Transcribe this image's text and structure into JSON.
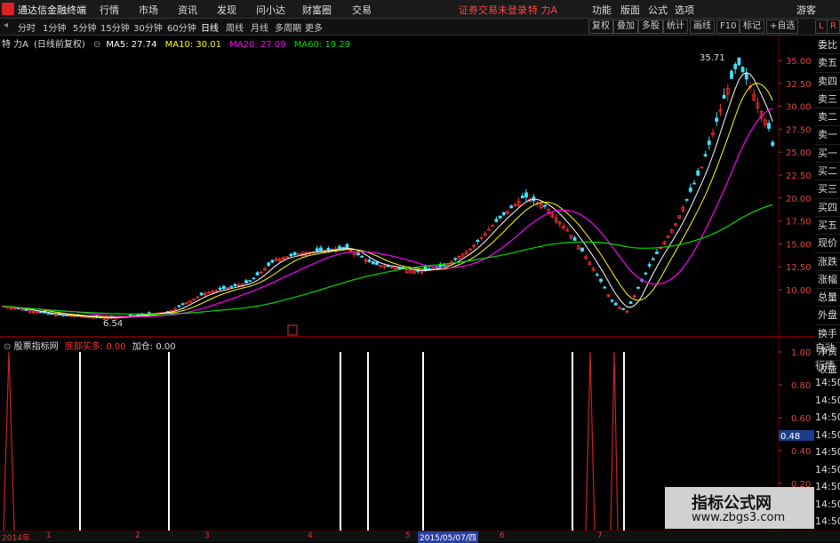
{
  "menubar": {
    "app_name": "通达信金融终端",
    "items": [
      "行情",
      "市场",
      "资讯",
      "发现",
      "问小达",
      "财富圈",
      "交易"
    ],
    "status": "证券交易未登录",
    "stock": "特 力A",
    "right_items": [
      "功能",
      "版面",
      "公式",
      "选项",
      "游客"
    ]
  },
  "toolbar": {
    "periods": [
      "分时",
      "1分钟",
      "5分钟",
      "15分钟",
      "30分钟",
      "60分钟",
      "日线",
      "周线",
      "月线",
      "多周期",
      "更多"
    ],
    "active": "日线",
    "right_buttons": [
      "复权",
      "叠加",
      "多股",
      "统计",
      "画线",
      "F10",
      "标记",
      "+自选",
      "L",
      "R"
    ]
  },
  "legend": {
    "title": "特 力A",
    "adjust": "(日线前复权)",
    "ma5": "MA5: 27.74",
    "ma10": "MA10: 30.01",
    "ma20": "MA20: 27.09",
    "ma60": "MA60: 19.29",
    "colors": {
      "ma5": "#ffffff",
      "ma10": "#ffff00",
      "ma20": "#ff00ff",
      "ma60": "#00ff00"
    }
  },
  "price_axis": [
    "35.00",
    "32.50",
    "30.00",
    "27.50",
    "25.00",
    "22.50",
    "20.00",
    "17.50",
    "15.00",
    "12.50",
    "10.00"
  ],
  "annotations": {
    "high": "35.71",
    "low": "6.54"
  },
  "quote_panel": [
    "委比",
    "卖五",
    "卖四",
    "卖三",
    "卖二",
    "卖一",
    "买一",
    "买二",
    "买三",
    "买四",
    "买五",
    "现价",
    "涨跌",
    "涨幅",
    "总量",
    "外盘",
    "换手",
    "净资",
    "收益"
  ],
  "indicator": {
    "name": "股票指标网",
    "label_buy": "底部买多",
    "buy_value": "0.00",
    "label_add": "加仓",
    "add_value": "0.00",
    "axis": [
      "1.00",
      "0.80",
      "0.60",
      "0.40",
      "0.20"
    ],
    "current": "0.48"
  },
  "quote_panel2": [
    "自动",
    "行情",
    "14:50",
    "14:50",
    "14:50",
    "14:50",
    "14:50",
    "14:50",
    "14:50",
    "14:50",
    "14:50"
  ],
  "datebar": {
    "year": "2014年",
    "ticks": [
      "1",
      "2",
      "3",
      "4",
      "5",
      "6",
      "7"
    ],
    "cursor": "2015/05/07/四"
  },
  "watermark": {
    "line1": "指标公式网",
    "line2": "www.zbgs3.com"
  }
}
